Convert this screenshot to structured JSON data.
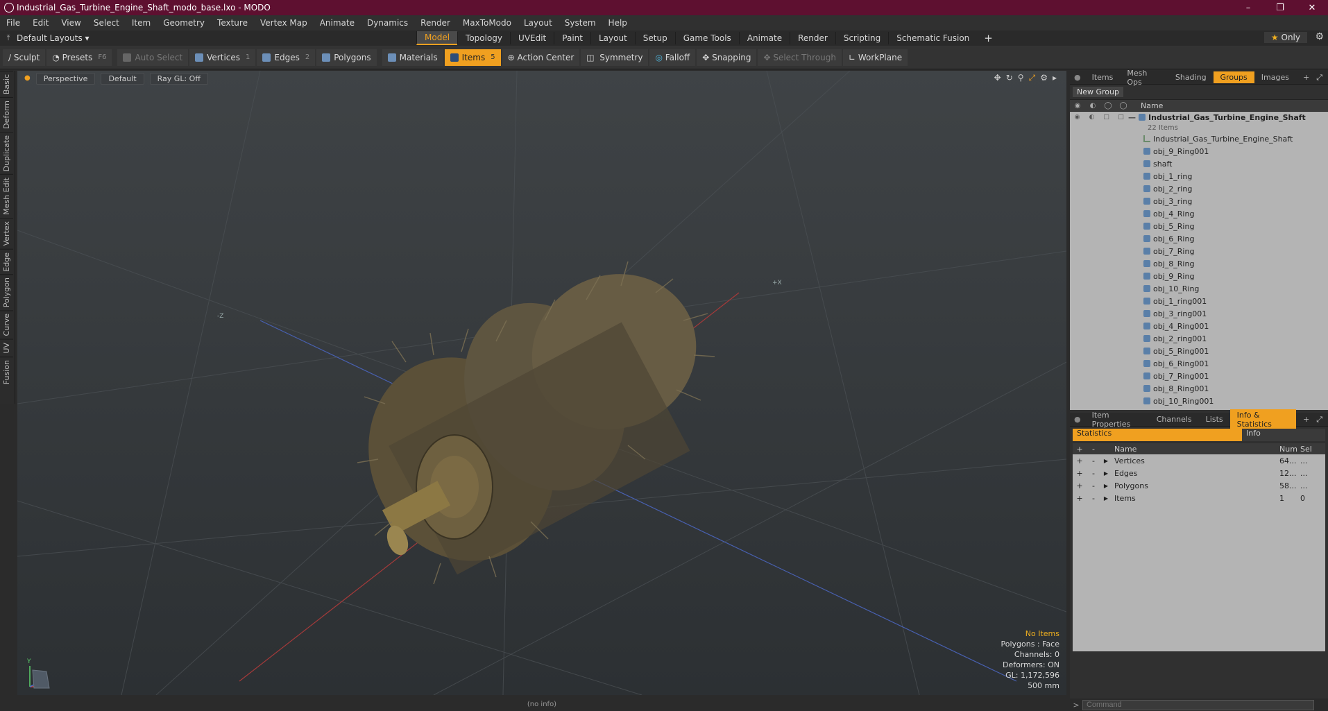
{
  "window": {
    "title": "Industrial_Gas_Turbine_Engine_Shaft_modo_base.lxo - MODO",
    "minimize": "–",
    "maximize": "❐",
    "close": "✕"
  },
  "menu": [
    "File",
    "Edit",
    "View",
    "Select",
    "Item",
    "Geometry",
    "Texture",
    "Vertex Map",
    "Animate",
    "Dynamics",
    "Render",
    "MaxToModo",
    "Layout",
    "System",
    "Help"
  ],
  "layout": {
    "preset": "Default Layouts ▾",
    "tabs": [
      "Model",
      "Topology",
      "UVEdit",
      "Paint",
      "Layout",
      "Setup",
      "Game Tools",
      "Animate",
      "Render",
      "Scripting",
      "Schematic Fusion"
    ],
    "active_tab": "Model",
    "plus": "+",
    "only": "Only"
  },
  "toolbar": {
    "sculpt": "Sculpt",
    "presets": "Presets",
    "presets_key": "F6",
    "auto_select": "Auto Select",
    "vertices": "Vertices",
    "vertices_key": "1",
    "edges": "Edges",
    "edges_key": "2",
    "polygons": "Polygons",
    "materials": "Materials",
    "items": "Items",
    "items_key": "5",
    "action_center": "Action Center",
    "symmetry": "Symmetry",
    "falloff": "Falloff",
    "snapping": "Snapping",
    "select_through": "Select Through",
    "workplane": "WorkPlane"
  },
  "left_tabs": [
    "Basic",
    "Deform",
    "Duplicate",
    "Mesh Edit",
    "Vertex",
    "Edge",
    "Polygon",
    "Curve",
    "UV",
    "Fusion"
  ],
  "viewport": {
    "perspective": "Perspective",
    "default": "Default",
    "raygl": "Ray GL: Off",
    "info": {
      "no_items": "No Items",
      "polygons": "Polygons : Face",
      "channels": "Channels: 0",
      "deformers": "Deformers: ON",
      "gl": "GL: 1,172,596",
      "scale": "500 mm"
    },
    "status": "(no info)"
  },
  "groups_panel": {
    "tabs": [
      "Items",
      "Mesh Ops",
      "Shading",
      "Groups",
      "Images"
    ],
    "active_tab": "Groups",
    "new_group": "New Group",
    "column_name": "Name",
    "root": "Industrial_Gas_Turbine_Engine_Shaft",
    "root_count": "22 Items",
    "items": [
      "Industrial_Gas_Turbine_Engine_Shaft",
      "obj_9_Ring001",
      "shaft",
      "obj_1_ring",
      "obj_2_ring",
      "obj_3_ring",
      "obj_4_Ring",
      "obj_5_Ring",
      "obj_6_Ring",
      "obj_7_Ring",
      "obj_8_Ring",
      "obj_9_Ring",
      "obj_10_Ring",
      "obj_1_ring001",
      "obj_3_ring001",
      "obj_4_Ring001",
      "obj_2_ring001",
      "obj_5_Ring001",
      "obj_6_Ring001",
      "obj_7_Ring001",
      "obj_8_Ring001",
      "obj_10_Ring001"
    ]
  },
  "stats_panel": {
    "tabs": [
      "Item Properties",
      "Channels",
      "Lists",
      "Info & Statistics"
    ],
    "active_tab": "Info & Statistics",
    "sub_statistics": "Statistics",
    "sub_info": "Info",
    "col_name": "Name",
    "col_num": "Num",
    "col_sel": "Sel",
    "rows": [
      {
        "name": "Vertices",
        "num": "64...",
        "sel": "..."
      },
      {
        "name": "Edges",
        "num": "12...",
        "sel": "..."
      },
      {
        "name": "Polygons",
        "num": "58...",
        "sel": "..."
      },
      {
        "name": "Items",
        "num": "1",
        "sel": "0"
      }
    ]
  },
  "command": {
    "placeholder": "Command",
    "prompt": ">"
  },
  "colors": {
    "title_bar": "#5e1030",
    "accent": "#f0a020",
    "viewport_top": "#3f4346",
    "viewport_bottom": "#2c3033"
  }
}
